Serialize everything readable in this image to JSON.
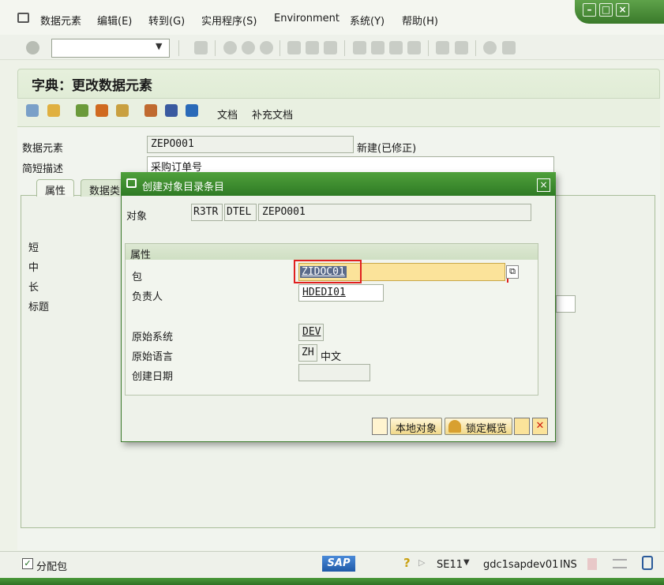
{
  "menubar": {
    "items": [
      "数据元素",
      "编辑(E)",
      "转到(G)",
      "实用程序(S)",
      "Environment",
      "系统(Y)",
      "帮助(H)"
    ]
  },
  "toolbar": {
    "command_value": ""
  },
  "page": {
    "title": "字典：更改数据元素",
    "app_toolbar": {
      "doc_label": "文档",
      "supp_doc_label": "补充文档"
    }
  },
  "main": {
    "data_element_label": "数据元素",
    "data_element_value": "ZEPO001",
    "status_text": "新建(已修正)",
    "short_desc_label": "简短描述",
    "short_desc_value": "采购订单号",
    "tabs": [
      "属性",
      "数据类"
    ],
    "field_labels": [
      "短",
      "中",
      "长",
      "标题"
    ]
  },
  "dialog": {
    "title": "创建对象目录条目",
    "object_label": "对象",
    "object_values": [
      "R3TR",
      "DTEL",
      "ZEPO001"
    ],
    "attr_header": "属性",
    "package_label": "包",
    "package_value": "ZIDOC01",
    "responsible_label": "负责人",
    "responsible_value": "HDEDI01",
    "orig_system_label": "原始系统",
    "orig_system_value": "DEV",
    "orig_lang_label": "原始语言",
    "orig_lang_value": "ZH",
    "orig_lang_name": "中文",
    "created_label": "创建日期",
    "created_value": "",
    "buttons": {
      "local": "本地对象",
      "lock": "锁定概览"
    }
  },
  "statusbar": {
    "checkbox_label": "分配包",
    "logo": "SAP",
    "transaction": "SE11",
    "server": "gdc1sapdev01",
    "mode": "INS"
  },
  "colors": {
    "accent_green": "#3a8a2e",
    "highlight_red": "#e02020",
    "input_yellow": "#fbe39a"
  }
}
